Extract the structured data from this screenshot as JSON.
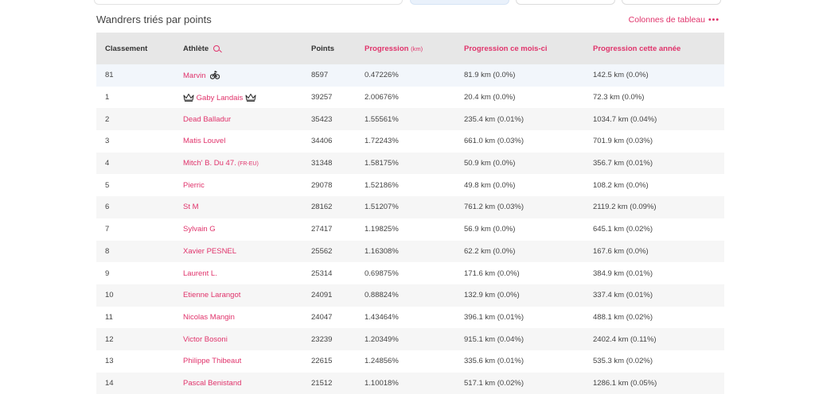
{
  "header": {
    "title": "Wandrers triés par points",
    "columns_link": "Colonnes de tableau",
    "columns_dots": "•••"
  },
  "table": {
    "columns": {
      "rank": "Classement",
      "athlete": "Athlète",
      "points": "Points",
      "progress": "Progression",
      "progress_unit": "(km)",
      "progress_month": "Progression ce mois-ci",
      "progress_year": "Progression cette année"
    },
    "rows": [
      {
        "rank": "81",
        "athlete": "Marvin",
        "points": "8597",
        "progress": "0.47226%",
        "month": "81.9 km (0.0%)",
        "year": "142.5 km (0.0%)"
      },
      {
        "rank": "1",
        "athlete": "Gaby Landais",
        "points": "39257",
        "progress": "2.00676%",
        "month": "20.4 km (0.0%)",
        "year": "72.3 km (0.0%)"
      },
      {
        "rank": "2",
        "athlete": "Dead Balladur",
        "points": "35423",
        "progress": "1.55561%",
        "month": "235.4 km (0.01%)",
        "year": "1034.7 km (0.04%)"
      },
      {
        "rank": "3",
        "athlete": "Matis Louvel",
        "points": "34406",
        "progress": "1.72243%",
        "month": "661.0 km (0.03%)",
        "year": "701.9 km (0.03%)"
      },
      {
        "rank": "4",
        "athlete": "Mitch' B. Du 47.",
        "tag": "(FR-EU)",
        "points": "31348",
        "progress": "1.58175%",
        "month": "50.9 km (0.0%)",
        "year": "356.7 km (0.01%)"
      },
      {
        "rank": "5",
        "athlete": "Pierric",
        "points": "29078",
        "progress": "1.52186%",
        "month": "49.8 km (0.0%)",
        "year": "108.2 km (0.0%)"
      },
      {
        "rank": "6",
        "athlete": "St M",
        "points": "28162",
        "progress": "1.51207%",
        "month": "761.2 km (0.03%)",
        "year": "2119.2 km (0.09%)"
      },
      {
        "rank": "7",
        "athlete": "Sylvain G",
        "points": "27417",
        "progress": "1.19825%",
        "month": "56.9 km (0.0%)",
        "year": "645.1 km (0.02%)"
      },
      {
        "rank": "8",
        "athlete": "Xavier PESNEL",
        "points": "25562",
        "progress": "1.16308%",
        "month": "62.2 km (0.0%)",
        "year": "167.6 km (0.0%)"
      },
      {
        "rank": "9",
        "athlete": "Laurent L.",
        "points": "25314",
        "progress": "0.69875%",
        "month": "171.6 km (0.0%)",
        "year": "384.9 km (0.01%)"
      },
      {
        "rank": "10",
        "athlete": "Etienne Larangot",
        "points": "24091",
        "progress": "0.88824%",
        "month": "132.9 km (0.0%)",
        "year": "337.4 km (0.01%)"
      },
      {
        "rank": "11",
        "athlete": "Nicolas Mangin",
        "points": "24047",
        "progress": "1.43464%",
        "month": "396.1 km (0.01%)",
        "year": "488.1 km (0.02%)"
      },
      {
        "rank": "12",
        "athlete": "Victor Bosoni",
        "points": "23239",
        "progress": "1.20349%",
        "month": "915.1 km (0.04%)",
        "year": "2402.4 km (0.11%)"
      },
      {
        "rank": "13",
        "athlete": "Philippe Thibeaut",
        "points": "22615",
        "progress": "1.24856%",
        "month": "335.6 km (0.01%)",
        "year": "535.3 km (0.02%)"
      },
      {
        "rank": "14",
        "athlete": "Pascal Benistand",
        "points": "21512",
        "progress": "1.10018%",
        "month": "517.1 km (0.02%)",
        "year": "1286.1 km (0.05%)"
      }
    ]
  },
  "colors": {
    "accent": "#e0336b",
    "header_bg": "#e7e7e7",
    "row_alt": "#f6f6f6",
    "row_me": "#f2f6fb"
  },
  "icons": {
    "header_search": "search-icon",
    "crown": "crown-icon",
    "bike": "bicycle-icon"
  }
}
